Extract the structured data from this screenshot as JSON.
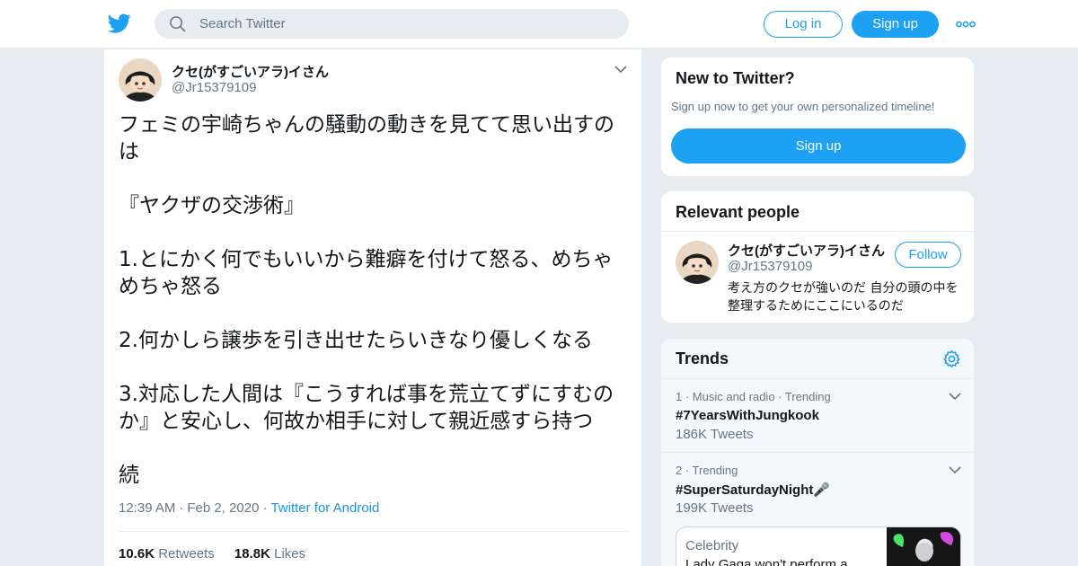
{
  "header": {
    "search_placeholder": "Search Twitter",
    "login_label": "Log in",
    "signup_label": "Sign up",
    "brand_color": "#1da1f2",
    "icons": [
      "twitter-bird-icon",
      "search-icon",
      "more-dots-icon"
    ]
  },
  "tweet": {
    "author_name": "クセ(がすごいアラ)イさん",
    "author_handle": "@Jr15379109",
    "lines": {
      "l1": "フェミの宇崎ちゃんの騒動の動きを見てて思い出すの",
      "l2": "は",
      "l3": "『ヤクザの交渉術』",
      "l4": "1.とにかく何でもいいから難癖を付けて怒る、めちゃ",
      "l5": "めちゃ怒る",
      "l6": "2.何かしら譲歩を引き出せたらいきなり優しくなる",
      "l7": "3.対応した人間は『こうすれば事を荒立てずにすむの",
      "l8": "か』と安心し、何故か相手に対して親近感すら持つ",
      "l9": "続"
    },
    "time": "12:39 AM",
    "date": "Feb 2, 2020",
    "source": "Twitter for Android",
    "retweets_count": "10.6K",
    "retweets_label": "Retweets",
    "likes_count": "18.8K",
    "likes_label": "Likes"
  },
  "new_to_twitter": {
    "title": "New to Twitter?",
    "subtitle": "Sign up now to get your own personalized timeline!",
    "button": "Sign up"
  },
  "relevant_people": {
    "title": "Relevant people",
    "name": "クセ(がすごいアラ)イさん",
    "handle": "@Jr15379109",
    "follow_label": "Follow",
    "bio": "考え方のクセが強いのだ 自分の頭の中を整理するためにここにいるのだ"
  },
  "trends": {
    "title": "Trends",
    "items": [
      {
        "context": "1 · Music and radio · Trending",
        "name": "#7YearsWithJungkook",
        "count": "186K Tweets"
      },
      {
        "context": "2 · Trending",
        "name": "#SuperSaturdayNight🎤",
        "count": "199K Tweets"
      }
    ],
    "news": {
      "category": "Celebrity",
      "headline": "Lady Gaga won't perform a"
    }
  }
}
